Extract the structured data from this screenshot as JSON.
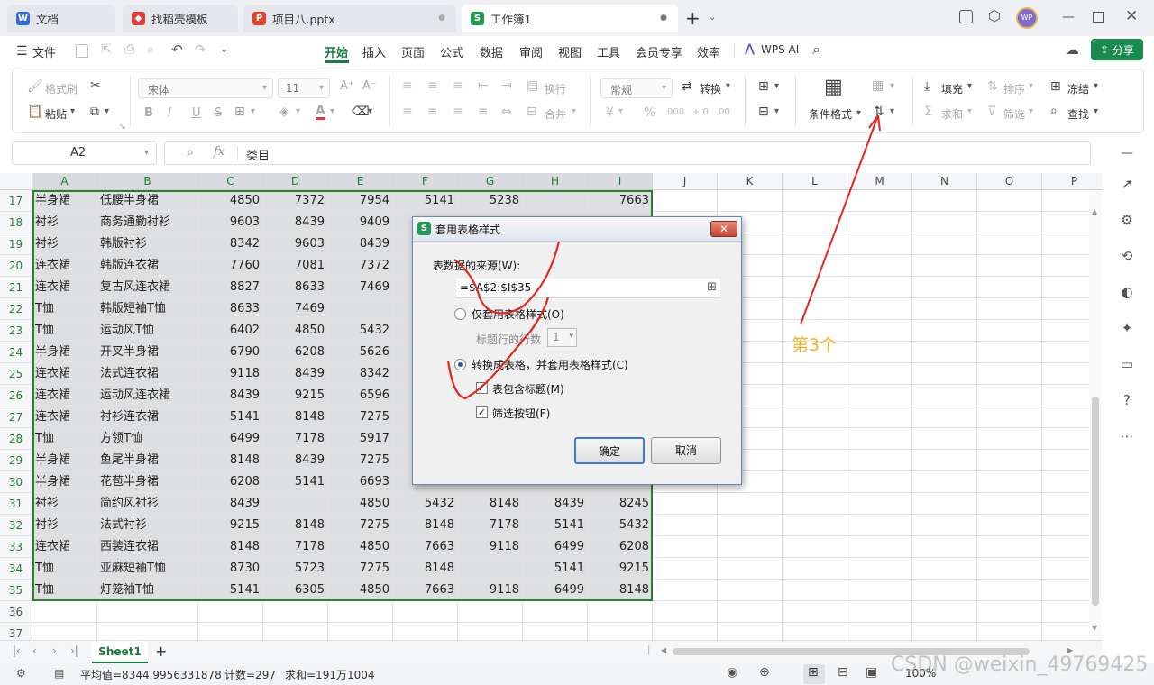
{
  "tabs": [
    {
      "label": "文档",
      "icon": "W",
      "icon_color": "#2f6bde"
    },
    {
      "label": "找稻壳模板",
      "icon": "◆",
      "icon_color": "#e23a3a"
    },
    {
      "label": "项目八.pptx",
      "icon": "P",
      "icon_color": "#e0452a"
    },
    {
      "label": "工作簿1",
      "icon": "S",
      "icon_color": "#1f9a55"
    }
  ],
  "window": {
    "new_tab": "+",
    "avatar": "WP"
  },
  "menu": {
    "file": "文件",
    "tabs": [
      "开始",
      "插入",
      "页面",
      "公式",
      "数据",
      "审阅",
      "视图",
      "工具",
      "会员专享",
      "效率"
    ],
    "active": "开始",
    "wps_ai": "WPS AI",
    "share": "分享"
  },
  "ribbon": {
    "format_painter": "格式刷",
    "paste": "粘贴",
    "font": "宋体",
    "font_size": "11",
    "wrap": "换行",
    "merge": "合并",
    "number_format": "常规",
    "convert": "转换",
    "cond_format": "条件格式",
    "fill": "填充",
    "sort": "排序",
    "freeze": "冻结",
    "sum": "求和",
    "filter": "筛选",
    "find": "查找"
  },
  "formula_bar": {
    "cell_ref": "A2",
    "fx": "fx",
    "content": "类目"
  },
  "columns": [
    "A",
    "B",
    "C",
    "D",
    "E",
    "F",
    "G",
    "H",
    "I",
    "J",
    "K",
    "L",
    "M",
    "N",
    "O",
    "P"
  ],
  "rows": [
    {
      "n": "17",
      "a": "半身裙",
      "b": "低腰半身裙",
      "c": "4850",
      "d": "7372",
      "e": "7954",
      "f": "5141",
      "g": "5238",
      "h": "",
      "i": "7663"
    },
    {
      "n": "18",
      "a": "衬衫",
      "b": "商务通勤衬衫",
      "c": "9603",
      "d": "8439",
      "e": "9409",
      "f": "",
      "g": "",
      "h": "",
      "i": ""
    },
    {
      "n": "19",
      "a": "衬衫",
      "b": "韩版衬衫",
      "c": "8342",
      "d": "9603",
      "e": "8439",
      "f": "",
      "g": "",
      "h": "",
      "i": ""
    },
    {
      "n": "20",
      "a": "连衣裙",
      "b": "韩版连衣裙",
      "c": "7760",
      "d": "7081",
      "e": "7372",
      "f": "",
      "g": "",
      "h": "",
      "i": ""
    },
    {
      "n": "21",
      "a": "连衣裙",
      "b": "复古风连衣裙",
      "c": "8827",
      "d": "8633",
      "e": "7469",
      "f": "",
      "g": "",
      "h": "",
      "i": ""
    },
    {
      "n": "22",
      "a": "T恤",
      "b": "韩版短袖T恤",
      "c": "8633",
      "d": "7469",
      "e": "",
      "f": "",
      "g": "",
      "h": "",
      "i": ""
    },
    {
      "n": "23",
      "a": "T恤",
      "b": "运动风T恤",
      "c": "6402",
      "d": "4850",
      "e": "5432",
      "f": "",
      "g": "",
      "h": "",
      "i": ""
    },
    {
      "n": "24",
      "a": "半身裙",
      "b": "开叉半身裙",
      "c": "6790",
      "d": "6208",
      "e": "5626",
      "f": "",
      "g": "",
      "h": "",
      "i": ""
    },
    {
      "n": "25",
      "a": "连衣裙",
      "b": "法式连衣裙",
      "c": "9118",
      "d": "8439",
      "e": "8342",
      "f": "",
      "g": "",
      "h": "",
      "i": ""
    },
    {
      "n": "26",
      "a": "连衣裙",
      "b": "运动风连衣裙",
      "c": "8439",
      "d": "9215",
      "e": "6596",
      "f": "",
      "g": "",
      "h": "",
      "i": ""
    },
    {
      "n": "27",
      "a": "连衣裙",
      "b": "衬衫连衣裙",
      "c": "5141",
      "d": "8148",
      "e": "7275",
      "f": "",
      "g": "",
      "h": "",
      "i": ""
    },
    {
      "n": "28",
      "a": "T恤",
      "b": "方领T恤",
      "c": "6499",
      "d": "7178",
      "e": "5917",
      "f": "",
      "g": "",
      "h": "",
      "i": ""
    },
    {
      "n": "29",
      "a": "半身裙",
      "b": "鱼尾半身裙",
      "c": "8148",
      "d": "8439",
      "e": "7275",
      "f": "",
      "g": "",
      "h": "",
      "i": ""
    },
    {
      "n": "30",
      "a": "半身裙",
      "b": "花苞半身裙",
      "c": "6208",
      "d": "5141",
      "e": "6693",
      "f": "",
      "g": "",
      "h": "",
      "i": ""
    },
    {
      "n": "31",
      "a": "衬衫",
      "b": "简约风衬衫",
      "c": "8439",
      "d": "",
      "e": "4850",
      "f": "5432",
      "g": "8148",
      "h": "8439",
      "i": "8245"
    },
    {
      "n": "32",
      "a": "衬衫",
      "b": "法式衬衫",
      "c": "9215",
      "d": "8148",
      "e": "7275",
      "f": "8148",
      "g": "7178",
      "h": "5141",
      "i": "5432"
    },
    {
      "n": "33",
      "a": "连衣裙",
      "b": "西装连衣裙",
      "c": "8148",
      "d": "7178",
      "e": "4850",
      "f": "7663",
      "g": "9118",
      "h": "6499",
      "i": "6208"
    },
    {
      "n": "34",
      "a": "T恤",
      "b": "亚麻短袖T恤",
      "c": "8730",
      "d": "5723",
      "e": "7275",
      "f": "8148",
      "g": "",
      "h": "5141",
      "i": "9215"
    },
    {
      "n": "35",
      "a": "T恤",
      "b": "灯笼袖T恤",
      "c": "5141",
      "d": "6305",
      "e": "4850",
      "f": "7663",
      "g": "9118",
      "h": "6499",
      "i": "8148"
    },
    {
      "n": "36",
      "a": "",
      "b": "",
      "c": "",
      "d": "",
      "e": "",
      "f": "",
      "g": "",
      "h": "",
      "i": ""
    },
    {
      "n": "37",
      "a": "",
      "b": "",
      "c": "",
      "d": "",
      "e": "",
      "f": "",
      "g": "",
      "h": "",
      "i": ""
    }
  ],
  "sheet_tabs": {
    "active": "Sheet1",
    "add": "+"
  },
  "status": {
    "average": "平均值=8344.9956331878",
    "count": "计数=297",
    "sum": "求和=191万1004",
    "zoom": "100%"
  },
  "dialog": {
    "title": "套用表格样式",
    "source_label": "表数据的来源(W):",
    "source_value": "=$A$2:$I$35",
    "option1": "仅套用表格样式(O)",
    "header_rows_label": "标题行的行数",
    "header_rows_value": "1",
    "option2": "转换成表格，并套用表格样式(C)",
    "check_header": "表包含标题(M)",
    "check_filter": "筛选按钮(F)",
    "ok": "确定",
    "cancel": "取消",
    "option1_selected": false,
    "option2_selected": true,
    "check_header_checked": true,
    "check_filter_checked": true
  },
  "annotation": {
    "text": "第3个",
    "color": "#f0b429",
    "stroke_color": "#e0281f"
  },
  "watermark": "CSDN @weixin_49769425"
}
